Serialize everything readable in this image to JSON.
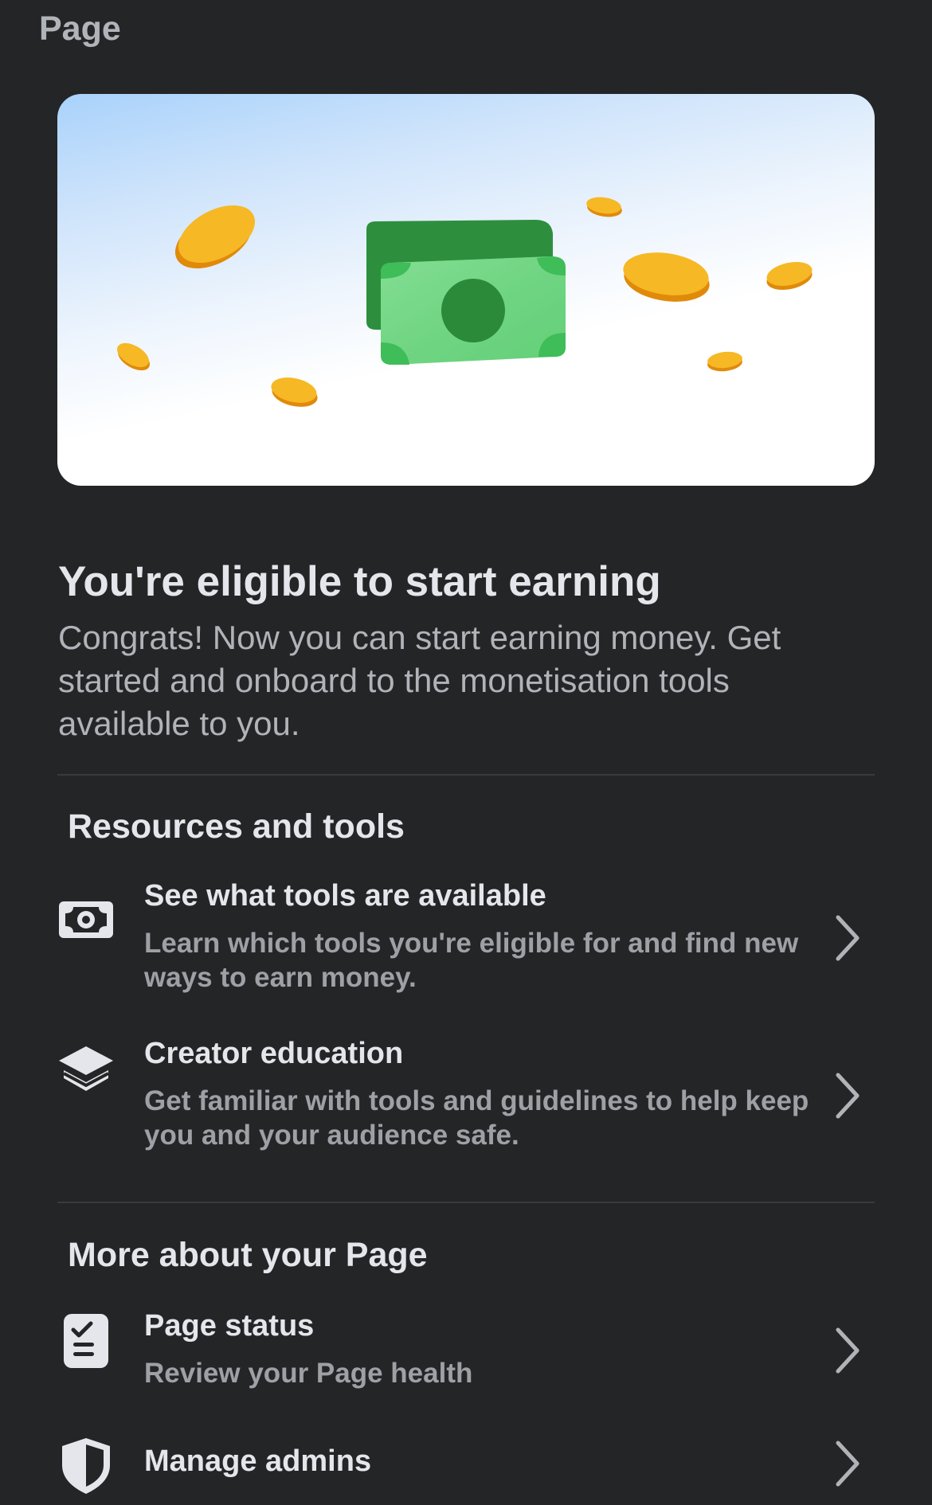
{
  "header": {
    "title": "Page"
  },
  "hero": {
    "colors": {
      "bill_dark": "#2f8f3f",
      "bill_light": "#7fdc8f",
      "coin": "#f5b51e",
      "coin_edge": "#e08a0a"
    }
  },
  "eligibility": {
    "headline": "You're eligible to start earning",
    "description": "Congrats! Now you can start earning money. Get started and onboard to the monetisation tools available to you."
  },
  "resources": {
    "section_title": "Resources and tools",
    "items": [
      {
        "icon": "money-icon",
        "title": "See what tools are available",
        "subtitle": "Learn which tools you're eligible for and find new ways to earn money."
      },
      {
        "icon": "education-icon",
        "title": "Creator education",
        "subtitle": "Get familiar with tools and guidelines to help keep you and your audience safe."
      }
    ]
  },
  "more": {
    "section_title": "More about your Page",
    "items": [
      {
        "icon": "clipboard-check-icon",
        "title": "Page status",
        "subtitle": "Review your Page health"
      },
      {
        "icon": "shield-icon",
        "title": "Manage admins",
        "subtitle": ""
      }
    ]
  }
}
